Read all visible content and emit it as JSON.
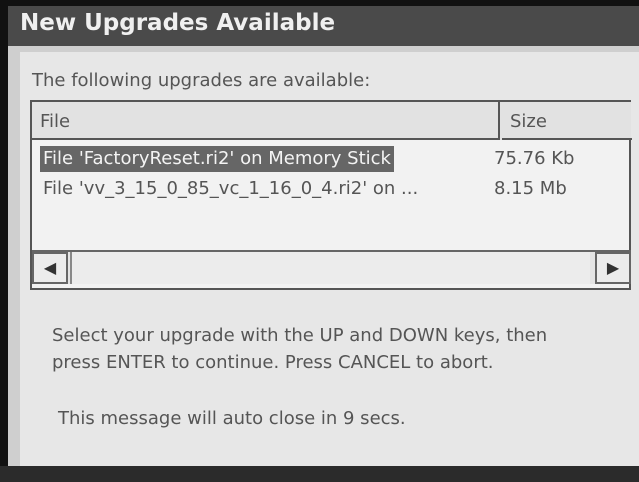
{
  "window": {
    "title": "New Upgrades Available"
  },
  "dialog": {
    "intro": "The following upgrades are available:",
    "columns": {
      "file": "File",
      "size": "Size"
    },
    "rows": [
      {
        "file": "File 'FactoryReset.ri2' on Memory Stick",
        "size": "75.76 Kb",
        "selected": true
      },
      {
        "file": "File 'vv_3_15_0_85_vc_1_16_0_4.ri2' on ...",
        "size": "8.15 Mb",
        "selected": false
      }
    ],
    "scroll_left_glyph": "◀",
    "scroll_right_glyph": "▶",
    "instructions_line1": "Select your upgrade with the UP and DOWN keys, then",
    "instructions_line2": "press ENTER to continue.  Press CANCEL to abort.",
    "autoclose": "This message will auto close in 9 secs."
  },
  "colors": {
    "title_bar": "#4a4a4a",
    "selection": "#666666",
    "background": "#e7e7e7"
  },
  "icons": {
    "scroll_left": "left-arrow-icon",
    "scroll_right": "right-arrow-icon"
  }
}
